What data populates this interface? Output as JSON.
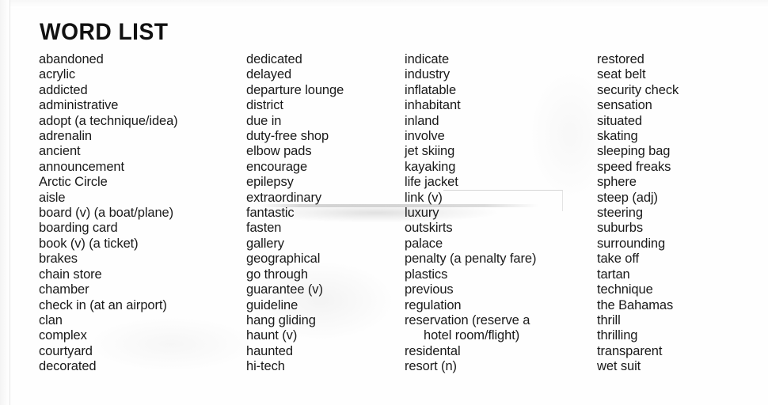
{
  "document": {
    "title": "WORD LIST",
    "type": "scanned-vocabulary-word-list",
    "background_color": "#fefefe",
    "text_color": "#1a1a1a"
  },
  "columns": [
    {
      "id": "column-1",
      "items": [
        {
          "text": "abandoned",
          "indent": false
        },
        {
          "text": "acrylic",
          "indent": false
        },
        {
          "text": "addicted",
          "indent": false
        },
        {
          "text": "administrative",
          "indent": false
        },
        {
          "text": "adopt (a technique/idea)",
          "indent": false
        },
        {
          "text": "adrenalin",
          "indent": false
        },
        {
          "text": "ancient",
          "indent": false
        },
        {
          "text": "announcement",
          "indent": false
        },
        {
          "text": "Arctic Circle",
          "indent": false
        },
        {
          "text": "aisle",
          "indent": false
        },
        {
          "text": "board (v) (a boat/plane)",
          "indent": false
        },
        {
          "text": "boarding card",
          "indent": false
        },
        {
          "text": "book (v) (a ticket)",
          "indent": false
        },
        {
          "text": "brakes",
          "indent": false
        },
        {
          "text": "chain store",
          "indent": false
        },
        {
          "text": "chamber",
          "indent": false
        },
        {
          "text": "check in (at an airport)",
          "indent": false
        },
        {
          "text": "clan",
          "indent": false
        },
        {
          "text": "complex",
          "indent": false
        },
        {
          "text": "courtyard",
          "indent": false
        },
        {
          "text": "decorated",
          "indent": false
        }
      ]
    },
    {
      "id": "column-2",
      "items": [
        {
          "text": "dedicated",
          "indent": false
        },
        {
          "text": "delayed",
          "indent": false
        },
        {
          "text": "departure lounge",
          "indent": false
        },
        {
          "text": "district",
          "indent": false
        },
        {
          "text": "due in",
          "indent": false
        },
        {
          "text": "duty-free shop",
          "indent": false
        },
        {
          "text": "elbow pads",
          "indent": false
        },
        {
          "text": "encourage",
          "indent": false
        },
        {
          "text": "epilepsy",
          "indent": false
        },
        {
          "text": "extraordinary",
          "indent": false
        },
        {
          "text": "fantastic",
          "indent": false
        },
        {
          "text": "fasten",
          "indent": false
        },
        {
          "text": "gallery",
          "indent": false
        },
        {
          "text": "geographical",
          "indent": false
        },
        {
          "text": "go through",
          "indent": false
        },
        {
          "text": "guarantee (v)",
          "indent": false
        },
        {
          "text": "guideline",
          "indent": false
        },
        {
          "text": "hang gliding",
          "indent": false
        },
        {
          "text": "haunt (v)",
          "indent": false
        },
        {
          "text": "haunted",
          "indent": false
        },
        {
          "text": "hi-tech",
          "indent": false
        }
      ]
    },
    {
      "id": "column-3",
      "items": [
        {
          "text": "indicate",
          "indent": false
        },
        {
          "text": "industry",
          "indent": false
        },
        {
          "text": "inflatable",
          "indent": false
        },
        {
          "text": "inhabitant",
          "indent": false
        },
        {
          "text": "inland",
          "indent": false
        },
        {
          "text": "involve",
          "indent": false
        },
        {
          "text": "jet skiing",
          "indent": false
        },
        {
          "text": "kayaking",
          "indent": false
        },
        {
          "text": "life jacket",
          "indent": false
        },
        {
          "text": "link (v)",
          "indent": false
        },
        {
          "text": "luxury",
          "indent": false
        },
        {
          "text": "outskirts",
          "indent": false
        },
        {
          "text": "palace",
          "indent": false
        },
        {
          "text": "penalty (a penalty fare)",
          "indent": false
        },
        {
          "text": "plastics",
          "indent": false
        },
        {
          "text": "previous",
          "indent": false
        },
        {
          "text": "regulation",
          "indent": false
        },
        {
          "text": "reservation (reserve a",
          "indent": false
        },
        {
          "text": "hotel room/flight)",
          "indent": true
        },
        {
          "text": "residental",
          "indent": false
        },
        {
          "text": "resort (n)",
          "indent": false
        }
      ]
    },
    {
      "id": "column-4",
      "items": [
        {
          "text": "restored",
          "indent": false
        },
        {
          "text": "seat belt",
          "indent": false
        },
        {
          "text": "security check",
          "indent": false
        },
        {
          "text": "sensation",
          "indent": false
        },
        {
          "text": "situated",
          "indent": false
        },
        {
          "text": "skating",
          "indent": false
        },
        {
          "text": "sleeping bag",
          "indent": false
        },
        {
          "text": "speed freaks",
          "indent": false
        },
        {
          "text": "sphere",
          "indent": false
        },
        {
          "text": "steep (adj)",
          "indent": false
        },
        {
          "text": "steering",
          "indent": false
        },
        {
          "text": "suburbs",
          "indent": false
        },
        {
          "text": "surrounding",
          "indent": false
        },
        {
          "text": "take off",
          "indent": false
        },
        {
          "text": "tartan",
          "indent": false
        },
        {
          "text": "technique",
          "indent": false
        },
        {
          "text": "the Bahamas",
          "indent": false
        },
        {
          "text": "thrill",
          "indent": false
        },
        {
          "text": "thrilling",
          "indent": false
        },
        {
          "text": "transparent",
          "indent": false
        },
        {
          "text": "wet suit",
          "indent": false
        }
      ]
    }
  ]
}
